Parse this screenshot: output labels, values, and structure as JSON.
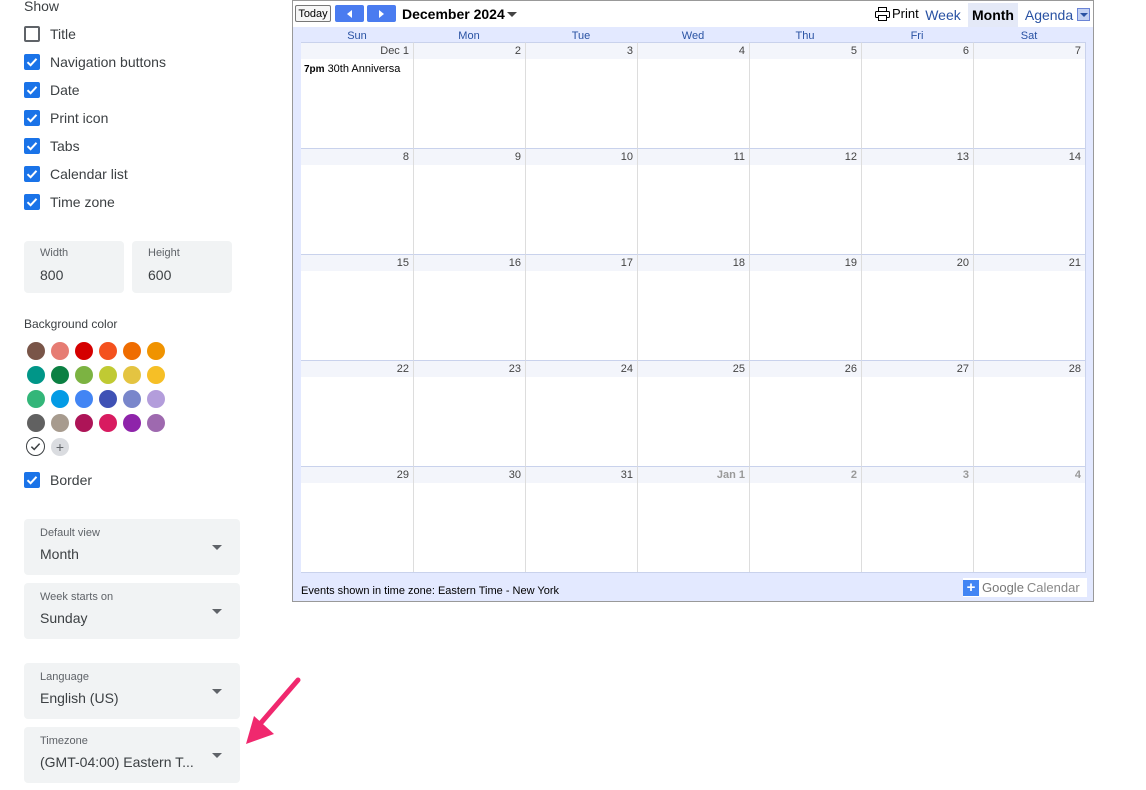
{
  "show": {
    "heading": "Show",
    "options": [
      {
        "label": "Title",
        "checked": false
      },
      {
        "label": "Navigation buttons",
        "checked": true
      },
      {
        "label": "Date",
        "checked": true
      },
      {
        "label": "Print icon",
        "checked": true
      },
      {
        "label": "Tabs",
        "checked": true
      },
      {
        "label": "Calendar list",
        "checked": true
      },
      {
        "label": "Time zone",
        "checked": true
      }
    ]
  },
  "size": {
    "width_label": "Width",
    "width_value": "800",
    "height_label": "Height",
    "height_value": "600"
  },
  "background": {
    "label": "Background color",
    "swatches": [
      [
        "#795548",
        "#e67c73",
        "#d50000",
        "#f4511e",
        "#ef6c00",
        "#f09300"
      ],
      [
        "#009688",
        "#0b8043",
        "#7cb342",
        "#c0ca33",
        "#e4c441",
        "#f6bf26"
      ],
      [
        "#33b679",
        "#039be5",
        "#4285f4",
        "#3f51b5",
        "#7986cb",
        "#b39ddb"
      ],
      [
        "#616161",
        "#a79b8e",
        "#ad1457",
        "#d81b60",
        "#8e24aa",
        "#9e69af"
      ]
    ],
    "selected_icon": "check-circle-icon",
    "add_icon": "plus-circle-icon"
  },
  "border": {
    "label": "Border",
    "checked": true
  },
  "selects": {
    "default_view": {
      "label": "Default view",
      "value": "Month"
    },
    "week_starts": {
      "label": "Week starts on",
      "value": "Sunday"
    },
    "language": {
      "label": "Language",
      "value": "English (US)"
    },
    "timezone": {
      "label": "Timezone",
      "value": "(GMT-04:00) Eastern T..."
    }
  },
  "calendar": {
    "today_label": "Today",
    "title": "December 2024",
    "print_label": "Print",
    "tabs": {
      "week": "Week",
      "month": "Month",
      "agenda": "Agenda"
    },
    "weekdays": [
      "Sun",
      "Mon",
      "Tue",
      "Wed",
      "Thu",
      "Fri",
      "Sat"
    ],
    "weeks": [
      [
        "Dec 1",
        "2",
        "3",
        "4",
        "5",
        "6",
        "7"
      ],
      [
        "8",
        "9",
        "10",
        "11",
        "12",
        "13",
        "14"
      ],
      [
        "15",
        "16",
        "17",
        "18",
        "19",
        "20",
        "21"
      ],
      [
        "22",
        "23",
        "24",
        "25",
        "26",
        "27",
        "28"
      ],
      [
        "29",
        "30",
        "31",
        "Jan 1",
        "2",
        "3",
        "4"
      ]
    ],
    "event": {
      "time": "7pm",
      "title": "30th Anniversa"
    },
    "footer_tz": "Events shown in time zone: Eastern Time - New York",
    "brand_google": "Google",
    "brand_calendar": "Calendar",
    "accent": "#2952a3",
    "header_bg": "#e3e9ff"
  },
  "annotation": {
    "color": "#f0286e",
    "icon": "arrow-icon"
  }
}
